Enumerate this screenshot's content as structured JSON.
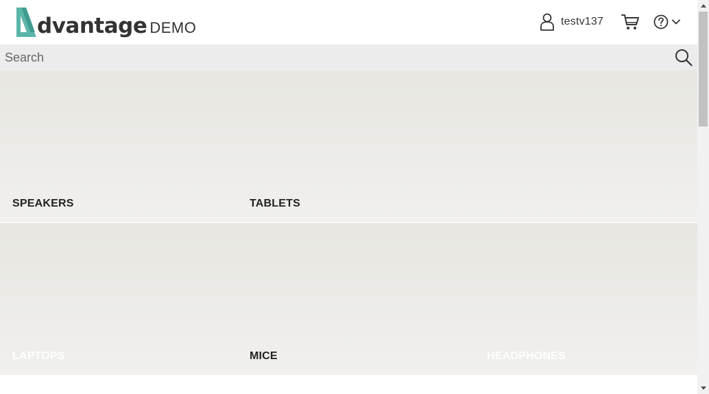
{
  "header": {
    "logo_word": "dvantage",
    "logo_demo": "DEMO",
    "username": "testv137",
    "icons": {
      "logo": "logo-a-icon",
      "user": "user-icon",
      "cart": "cart-icon",
      "help": "help-icon",
      "chevron": "chevron-down-icon"
    }
  },
  "search": {
    "placeholder": "Search",
    "value": "",
    "icon": "search-icon"
  },
  "categories": [
    {
      "label": "SPEAKERS",
      "style": "dark"
    },
    {
      "label": "TABLETS",
      "style": "dark"
    },
    {
      "label": "",
      "style": "dark"
    },
    {
      "label": "LAPTOPS",
      "style": "light"
    },
    {
      "label": "MICE",
      "style": "dark"
    },
    {
      "label": "HEADPHONES",
      "style": "light"
    }
  ],
  "colors": {
    "brand_teal": "#5bb5a9",
    "text_dark": "#333333",
    "search_bg": "#ececec",
    "tile_top": "#e7e6e1",
    "tile_bottom": "#f1f0ed"
  }
}
